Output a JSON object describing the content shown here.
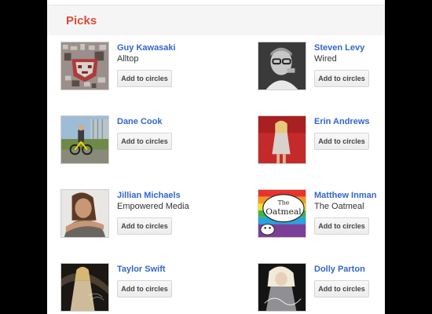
{
  "header": {
    "title": "Picks"
  },
  "people": [
    {
      "name": "Guy Kawasaki",
      "subtitle": "Alltop",
      "button": "Add to circles",
      "avatar_icon": "mosaic-portrait-icon"
    },
    {
      "name": "Steven Levy",
      "subtitle": "Wired",
      "button": "Add to circles",
      "avatar_icon": "portrait-photo-icon"
    },
    {
      "name": "Dane Cook",
      "subtitle": "",
      "button": "Add to circles",
      "avatar_icon": "outdoor-photo-icon"
    },
    {
      "name": "Erin Andrews",
      "subtitle": "",
      "button": "Add to circles",
      "avatar_icon": "red-carpet-photo-icon"
    },
    {
      "name": "Jillian Michaels",
      "subtitle": "Empowered Media",
      "button": "Add to circles",
      "avatar_icon": "portrait-photo-icon"
    },
    {
      "name": "Matthew Inman",
      "subtitle": "The Oatmeal",
      "button": "Add to circles",
      "avatar_icon": "oatmeal-logo-icon"
    },
    {
      "name": "Taylor Swift",
      "subtitle": "",
      "button": "Add to circles",
      "avatar_icon": "album-cover-icon"
    },
    {
      "name": "Dolly Parton",
      "subtitle": "",
      "button": "Add to circles",
      "avatar_icon": "album-cover-icon"
    }
  ],
  "oatmeal_logo": {
    "line1": "The",
    "line2": "Oatmeal"
  },
  "colors": {
    "accent": "#dd4b39",
    "link": "#3366cc"
  }
}
